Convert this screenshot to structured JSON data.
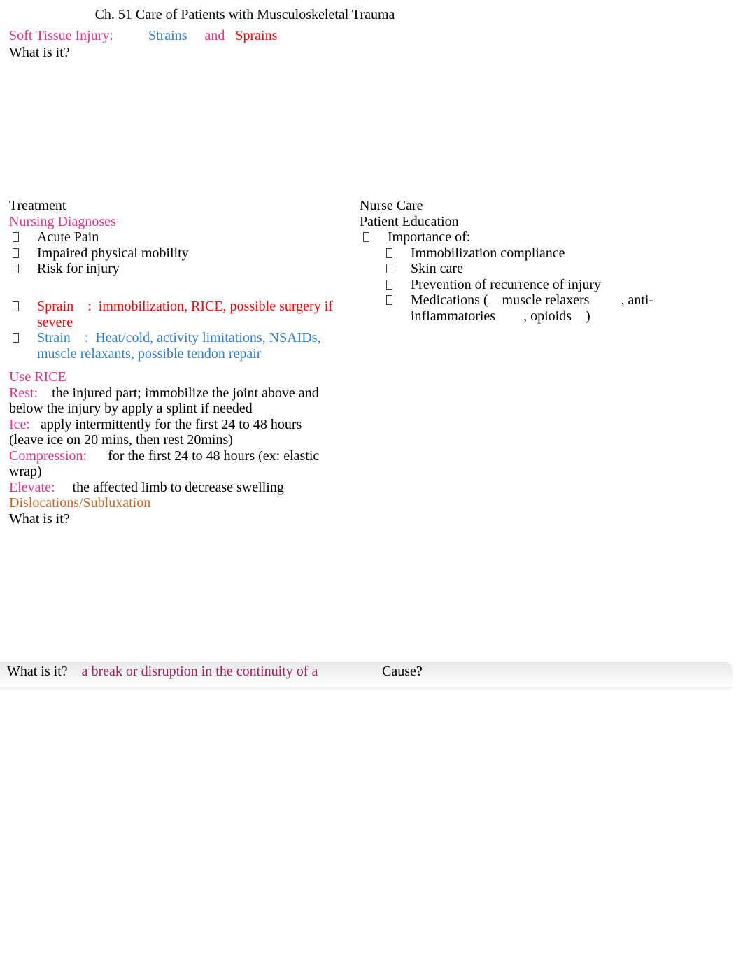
{
  "document": {
    "title": "Ch. 51 Care of Patients with Musculoskeletal Trauma"
  },
  "top_section": {
    "label": "Soft Tissue Injury:",
    "term_strains": "Strains",
    "conjunction": "and",
    "term_sprains": "Sprains",
    "prompt": "What is it?"
  },
  "left_column": {
    "treatment_heading": "Treatment",
    "nursing_diagnoses_heading": "Nursing Diagnoses",
    "diagnoses": [
      "Acute Pain",
      "Impaired physical mobility",
      "Risk for injury"
    ],
    "sprain_label": "Sprain",
    "sprain_colon": ":",
    "sprain_text": "immobilization, RICE, possible surgery if severe",
    "strain_label": "Strain",
    "strain_colon": ":",
    "strain_text": "Heat/cold, activity limitations, NSAIDs, muscle relaxants, possible tendon repair"
  },
  "right_column": {
    "nurse_care_heading": "Nurse Care",
    "patient_education_heading": "Patient Education",
    "importance_of": "Importance of:",
    "sub_items": [
      "Immobilization compliance",
      "Skin care",
      "Prevention of recurrence of injury",
      "Medications (    muscle relaxers         , anti-inflammatories        , opioids    )"
    ]
  },
  "rice_section": {
    "heading": "Use RICE",
    "rest_label": "Rest:",
    "rest_text": "the injured part; immobilize the joint above and below the injury by apply a splint if needed",
    "ice_label": "Ice:",
    "ice_text": "apply intermittently for the first 24 to 48 hours (leave ice on 20 mins, then rest 20mins)",
    "compression_label": "Compression:",
    "compression_text": "for the first 24 to 48 hours (ex: elastic wrap)",
    "elevate_label": "Elevate:",
    "elevate_text": "the affected limb to decrease swelling"
  },
  "dislocation_section": {
    "heading": "Dislocations/Subluxation",
    "prompt": "What is it?"
  },
  "banner": {
    "prompt": "What is it?",
    "answer": "a break or disruption in the continuity of a",
    "cause_prompt": "Cause?"
  },
  "colors": {
    "pink": "#E8308A",
    "blue": "#2E7FD4",
    "red": "#FF0000",
    "orange": "#CC6622",
    "maroon": "#A8205A",
    "black": "#000000"
  }
}
